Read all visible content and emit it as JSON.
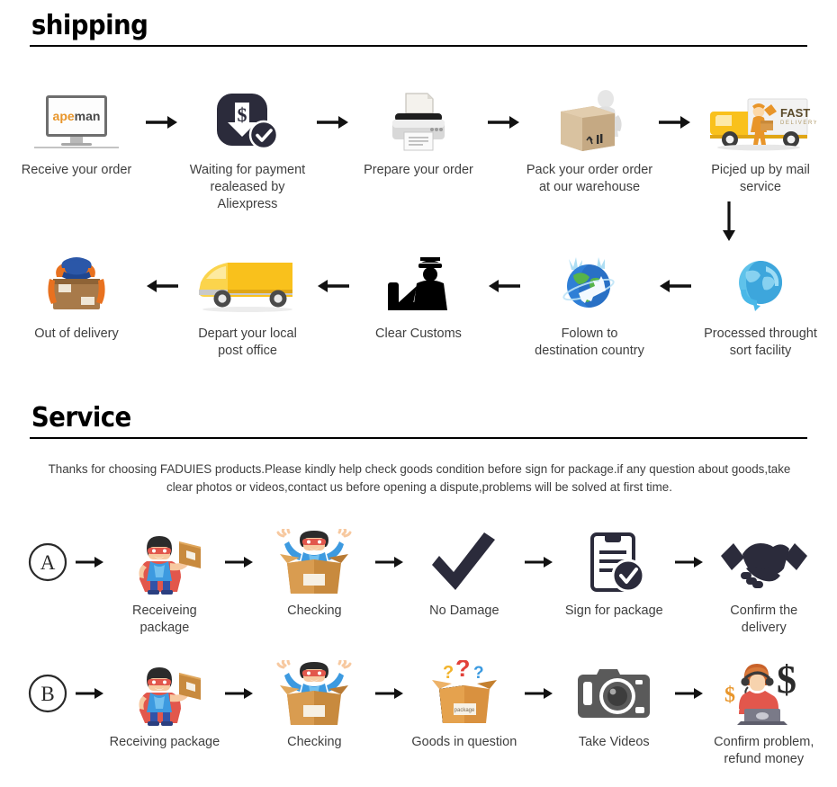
{
  "shipping": {
    "heading": "shipping",
    "row1": [
      {
        "label": "Receive your order",
        "icon": "monitor-apeman-icon",
        "brand": "apeman"
      },
      {
        "label": "Waiting for payment\nrealeased by Aliexpress",
        "icon": "payment-released-icon"
      },
      {
        "label": "Prepare your order",
        "icon": "printer-icon"
      },
      {
        "label": "Pack your order order\nat our warehouse",
        "icon": "packing-box-worker-icon"
      },
      {
        "label": "Picjed up by mail service",
        "icon": "fast-delivery-truck-icon",
        "truck_text": "FAST",
        "truck_subtext": "DELIVERY"
      }
    ],
    "row2": [
      {
        "label": "Out of delivery",
        "icon": "courier-carrying-box-icon"
      },
      {
        "label": "Depart your local\npost office",
        "icon": "delivery-van-icon"
      },
      {
        "label": "Clear Customs",
        "icon": "customs-officer-icon"
      },
      {
        "label": "Folown to\ndestination country",
        "icon": "globe-airplane-icon"
      },
      {
        "label": "Processed throught\nsort facility",
        "icon": "globe-sorting-icon"
      }
    ],
    "row1_arrows": [
      "arrow-right-icon",
      "arrow-right-icon",
      "arrow-right-icon",
      "arrow-right-icon"
    ],
    "row2_arrows": [
      "arrow-left-icon",
      "arrow-left-icon",
      "arrow-left-icon",
      "arrow-left-icon"
    ],
    "vertical_arrow": "arrow-down-icon"
  },
  "service": {
    "heading": "Service",
    "paragraph": "Thanks for choosing FADUIES products.Please kindly help check goods condition before sign for package.if any question about goods,take clear photos or videos,contact us before opening a dispute,problems will be solved at first time.",
    "row_a": {
      "marker": "A",
      "steps": [
        {
          "label": "Receiveing package",
          "icon": "hero-holding-box-icon"
        },
        {
          "label": "Checking",
          "icon": "hero-in-open-box-icon"
        },
        {
          "label": "No Damage",
          "icon": "checkmark-icon"
        },
        {
          "label": "Sign for package",
          "icon": "clipboard-check-icon"
        },
        {
          "label": "Confirm the delivery",
          "icon": "handshake-icon"
        }
      ],
      "arrows": [
        "arrow-right-icon",
        "arrow-right-icon",
        "arrow-right-icon",
        "arrow-right-icon",
        "arrow-right-icon"
      ]
    },
    "row_b": {
      "marker": "B",
      "steps": [
        {
          "label": "Receiving package",
          "icon": "hero-holding-box-icon"
        },
        {
          "label": "Checking",
          "icon": "hero-in-open-box-icon"
        },
        {
          "label": "Goods in question",
          "icon": "box-question-marks-icon",
          "box_text": "package"
        },
        {
          "label": "Take Videos",
          "icon": "camera-icon"
        },
        {
          "label": "Confirm problem,\nrefund money",
          "icon": "support-agent-refund-icon"
        }
      ],
      "arrows": [
        "arrow-right-icon",
        "arrow-right-icon",
        "arrow-right-icon",
        "arrow-right-icon",
        "arrow-right-icon"
      ]
    }
  },
  "colors": {
    "rule": "#000000",
    "heading": "#000000",
    "label_text": "#3f3f3f",
    "dark_navy": "#2b2b3b",
    "brand_orange": "#e8952a",
    "brand_gray": "#4a4a4a",
    "truck_yellow": "#f9c11c",
    "box_tan": "#c9a980",
    "hero_blue": "#3d9ae0",
    "hero_red": "#e2574c",
    "globe_blue": "#3aa0d8",
    "camera_gray": "#5a5a5a"
  }
}
